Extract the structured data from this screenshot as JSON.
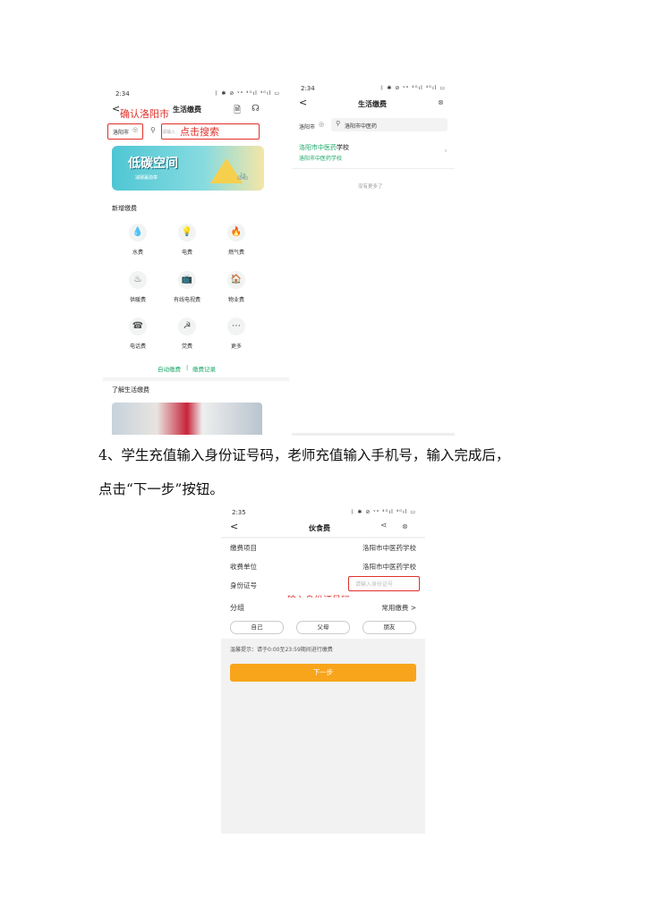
{
  "screen1": {
    "time": "2:34",
    "status_icons": "ᛒ ✱ ⊘ ᵛᵒ ⁴ᴳıl ⁴ᴳıl ▭",
    "back": "<",
    "title": "生活缴费",
    "anno_city": "确认洛阳市",
    "city": "洛阳市",
    "search_placeholder": "请输入",
    "anno_search": "点击搜索",
    "banner_title": "低碳空间",
    "banner_sub": "减碳赢勋章",
    "section_new": "新增缴费",
    "grid": [
      {
        "icon": "💧",
        "label": "水费"
      },
      {
        "icon": "💡",
        "label": "电费"
      },
      {
        "icon": "🔥",
        "label": "燃气费"
      },
      {
        "icon": "♨",
        "label": "供暖费"
      },
      {
        "icon": "📺",
        "label": "有线电视费"
      },
      {
        "icon": "🏠",
        "label": "物业费"
      },
      {
        "icon": "☎",
        "label": "电话费"
      },
      {
        "icon": "☭",
        "label": "党费"
      },
      {
        "icon": "⋯",
        "label": "更多"
      }
    ],
    "auto_pay": "自动缴费",
    "divider": "|",
    "records": "缴费记录",
    "section_learn": "了解生活缴费"
  },
  "screen2": {
    "time": "2:34",
    "status_icons": "ᛒ ✱ ⊘ ᵛᵒ ⁴ᴳıl ⁴ᴳıl ▭",
    "back": "<",
    "title": "生活缴费",
    "city": "洛阳市",
    "search_value": "洛阳市中医药",
    "result_title_hl": "洛阳市中医药",
    "result_title_rest": "学校",
    "result_sub_hl": "洛阳市中医药",
    "result_sub_rest": "学校",
    "no_more": "没有更多了"
  },
  "instruction": {
    "line1": "4、学生充值输入身份证号码，老师充值输入手机号，输入完成后，",
    "line2": "点击“下一步”按钮。"
  },
  "screen3": {
    "time": "2:35",
    "status_icons": "ᛒ ✱ ⊘ ᵛᵒ ⁴ᴳıl ⁴ᴳıl ▭",
    "back": "<",
    "title": "伙食费",
    "rows": [
      {
        "label": "缴费项目",
        "value": "洛阳市中医药学校"
      },
      {
        "label": "收费单位",
        "value": "洛阳市中医药学校"
      }
    ],
    "id_label": "身份证号",
    "id_placeholder": "请输入身份证号",
    "anno_id": "输入身份证号码",
    "group_label": "分组",
    "group_value": "常用缴费 >",
    "pills": [
      "自己",
      "父母",
      "朋友"
    ],
    "tip": "温馨提示：请于0:00至23:59期间进行缴费",
    "next": "下一步"
  },
  "colors": {
    "accent": "#1aa868",
    "button": "#f8a51c",
    "red": "#e0302a"
  }
}
